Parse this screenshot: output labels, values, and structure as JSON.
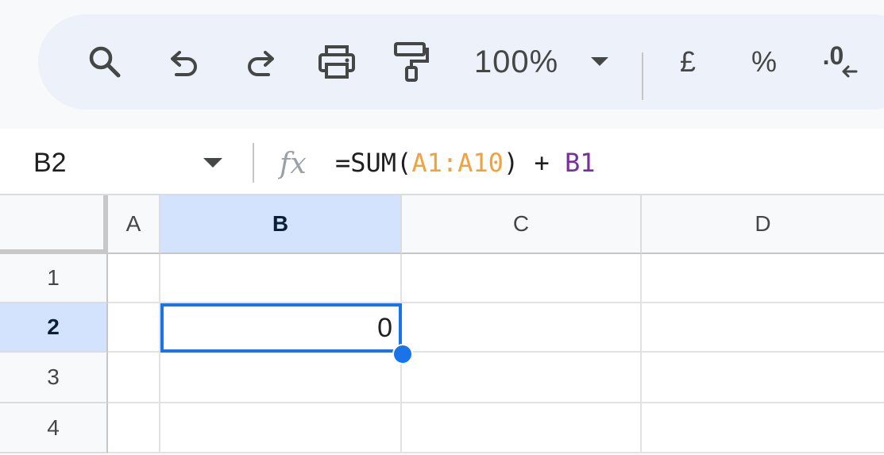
{
  "toolbar": {
    "icons": [
      "search-icon",
      "undo-icon",
      "redo-icon",
      "print-icon",
      "paint-format-icon"
    ],
    "zoom": "100%",
    "currency": "£",
    "percent": "%",
    "decimal_decrease": ".0"
  },
  "formula_bar": {
    "name_box": "B2",
    "formula_prefix": "=SUM(",
    "formula_range": "A1:A10",
    "formula_mid": ") + ",
    "formula_ref": "B1"
  },
  "grid": {
    "columns": [
      "A",
      "B",
      "C",
      "D"
    ],
    "rows": [
      "1",
      "2",
      "3",
      "4"
    ],
    "active_column": "B",
    "active_row": "2",
    "selected_value": "0"
  },
  "colors": {
    "selection": "#1a73e8",
    "header_active": "#d3e3fd",
    "range_ref": "#f3a23b",
    "cell_ref": "#7b2d9b"
  }
}
